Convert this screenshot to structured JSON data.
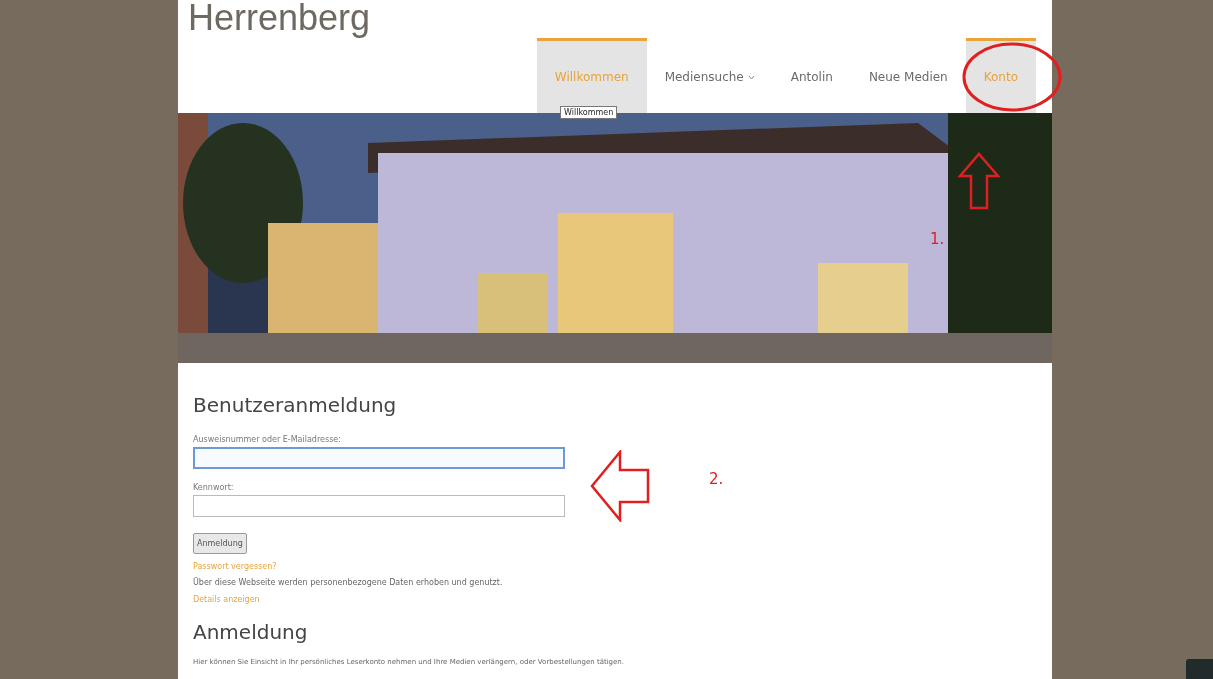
{
  "logo": "Herrenberg",
  "nav": [
    {
      "label": "Willkommen",
      "selected": true,
      "dropdown": false
    },
    {
      "label": "Mediensuche",
      "selected": false,
      "dropdown": true
    },
    {
      "label": "Antolin",
      "selected": false,
      "dropdown": false
    },
    {
      "label": "Neue Medien",
      "selected": false,
      "dropdown": false
    },
    {
      "label": "Konto",
      "selected": true,
      "dropdown": false
    }
  ],
  "tooltip": "Willkommen",
  "login": {
    "title": "Benutzeranmeldung",
    "fields": [
      {
        "label": "Ausweisnummer oder E-Mailadresse:",
        "focused": true
      },
      {
        "label": "Kennwort:",
        "focused": false
      }
    ],
    "button": "Anmeldung",
    "forgot_link": "Passwort vergessen?",
    "privacy_note": "Über diese Webseite werden personenbezogene Daten erhoben und genutzt.",
    "details_link": "Details anzeigen"
  },
  "section": {
    "title": "Anmeldung",
    "text": "Hier können Sie Einsicht in Ihr persönliches Leserkonto nehmen und Ihre Medien verlängern, oder Vorbestellungen tätigen."
  },
  "annotations": [
    {
      "label": "1."
    },
    {
      "label": "2."
    }
  ]
}
